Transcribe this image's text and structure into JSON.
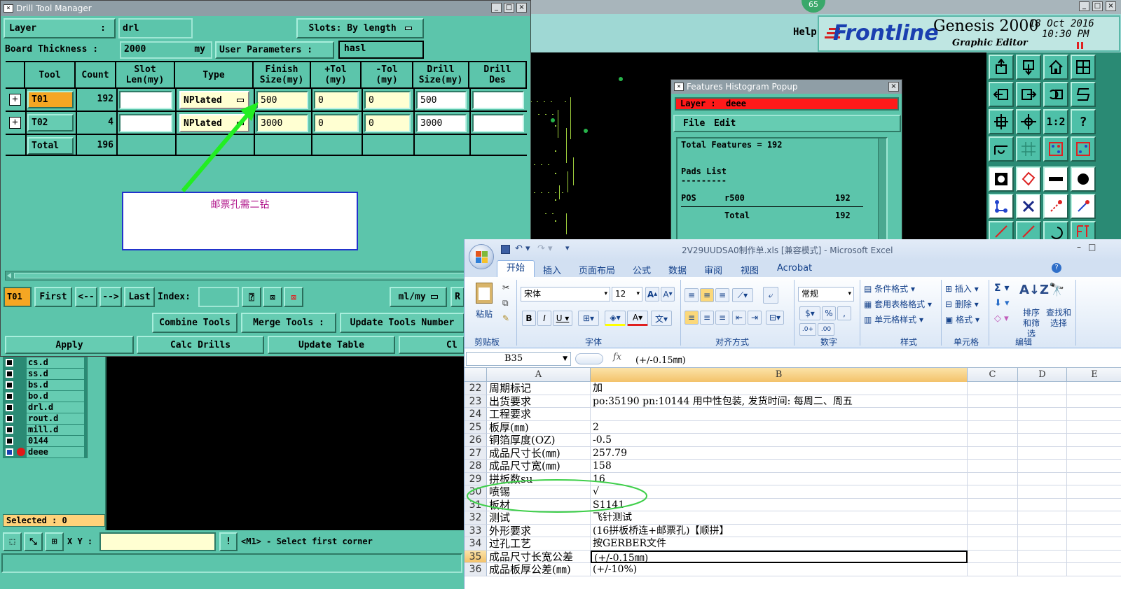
{
  "drill_window": {
    "title": "Drill Tool Manager",
    "layer_label": "Layer",
    "layer_value": "drl",
    "slots_label": "Slots:",
    "slots_value": "By length",
    "board_thickness_label": "Board Thickness :",
    "board_thickness_value": "2000",
    "board_thickness_unit": "my",
    "user_params_label": "User Parameters :",
    "user_params_value": "hasl",
    "columns": [
      "Tool",
      "Count",
      "Slot Len(my)",
      "Type",
      "Finish Size(my)",
      "+Tol (my)",
      "-Tol (my)",
      "Drill Size(my)",
      "Drill Des"
    ],
    "rows": [
      {
        "tool": "T01",
        "count": "192",
        "slot": "",
        "type": "NPlated",
        "finish": "500",
        "ptol": "0",
        "ntol": "0",
        "drill": "500",
        "des": ""
      },
      {
        "tool": "T02",
        "count": "4",
        "slot": "",
        "type": "NPlated",
        "finish": "3000",
        "ptol": "0",
        "ntol": "0",
        "drill": "3000",
        "des": ""
      }
    ],
    "total_label": "Total",
    "total_count": "196",
    "annotation_text": "邮票孔需二钻",
    "nav": {
      "current": "T01",
      "first": "First",
      "prev": "<--",
      "next": "-->",
      "last": "Last",
      "index_label": "Index:",
      "units": "ml/my"
    },
    "buttons": {
      "combine": "Combine Tools",
      "merge": "Merge Tools :",
      "update_num": "Update Tools Number",
      "apply": "Apply",
      "calc": "Calc Drills",
      "update_table": "Update Table",
      "close": "Cl"
    }
  },
  "layers_panel": {
    "items": [
      "cs.d",
      "ss.d",
      "bs.d",
      "bo.d",
      "drl.d",
      "rout.d",
      "mill.d",
      "0144",
      "deee"
    ],
    "selected_label": "Selected : 0"
  },
  "bottom_bar": {
    "xy_label": "X Y :",
    "xy_value": "",
    "message": "<M1> - Select first corner"
  },
  "genesis": {
    "badge": "65",
    "help": "Help",
    "brand": "Frontline",
    "product": "Genesis 2000",
    "subtitle": "Graphic Editor",
    "date": "18 Oct 2016",
    "time": "10:30 PM"
  },
  "histogram": {
    "title": "Features Histogram Popup",
    "layer_label": "Layer :",
    "layer_value": "deee",
    "menu": [
      "File",
      "Edit"
    ],
    "total": "Total Features = 192",
    "list_title": "Pads List",
    "dash1": "---------",
    "pos": "POS",
    "sym": "r500",
    "pos_count": "192",
    "total_label": "Total",
    "total_count": "192"
  },
  "excel": {
    "title": "2V29UUDSA0制作单.xls [兼容模式] - Microsoft Excel",
    "tabs": [
      "开始",
      "插入",
      "页面布局",
      "公式",
      "数据",
      "审阅",
      "视图",
      "Acrobat"
    ],
    "groups": [
      "剪贴板",
      "字体",
      "对齐方式",
      "数字",
      "样式",
      "单元格",
      "编辑"
    ],
    "font_name": "宋体",
    "font_size": "12",
    "number_format": "常规",
    "paste": "粘贴",
    "styles": [
      "条件格式",
      "套用表格格式",
      "单元格样式"
    ],
    "cells_btns": [
      "插入",
      "删除",
      "格式"
    ],
    "edit_btns": [
      "排序和筛选",
      "查找和选择"
    ],
    "name_box": "B35",
    "formula": "(+/-0.15㎜)",
    "columns": [
      "A",
      "B",
      "C",
      "D",
      "E"
    ],
    "rows": [
      {
        "n": "22",
        "a": "周期标记",
        "b": "加"
      },
      {
        "n": "23",
        "a": "出货要求",
        "b": "po:35190 pn:10144 用中性包装, 发货时间: 每周二、周五"
      },
      {
        "n": "24",
        "a": "工程要求",
        "b": ""
      },
      {
        "n": "25",
        "a": "板厚(㎜)",
        "b": "2"
      },
      {
        "n": "26",
        "a": "铜箔厚度(OZ)",
        "b": "-0.5"
      },
      {
        "n": "27",
        "a": "成品尺寸长(㎜)",
        "b": "257.79"
      },
      {
        "n": "28",
        "a": "成品尺寸宽(㎜)",
        "b": "158"
      },
      {
        "n": "29",
        "a": "拼板数su",
        "b": "16"
      },
      {
        "n": "30",
        "a": "喷锡",
        "b": "√"
      },
      {
        "n": "31",
        "a": "板材",
        "b": "S1141"
      },
      {
        "n": "32",
        "a": "测试",
        "b": "飞针测试"
      },
      {
        "n": "33",
        "a": "外形要求",
        "b": "(16拼板桥连+邮票孔)【顺拼】"
      },
      {
        "n": "34",
        "a": "过孔工艺",
        "b": "按GERBER文件"
      },
      {
        "n": "35",
        "a": "成品尺寸长宽公差",
        "b": "(+/-0.15㎜)"
      },
      {
        "n": "36",
        "a": "成品板厚公差(㎜)",
        "b": "(+/-10%)"
      }
    ]
  },
  "colors": {
    "teal": "#5cc5ab",
    "yellow_input": "#ffffd2",
    "annot_text": "#b0158a",
    "arrow": "#22ee22",
    "hist_layer": "#ff1a1a"
  }
}
